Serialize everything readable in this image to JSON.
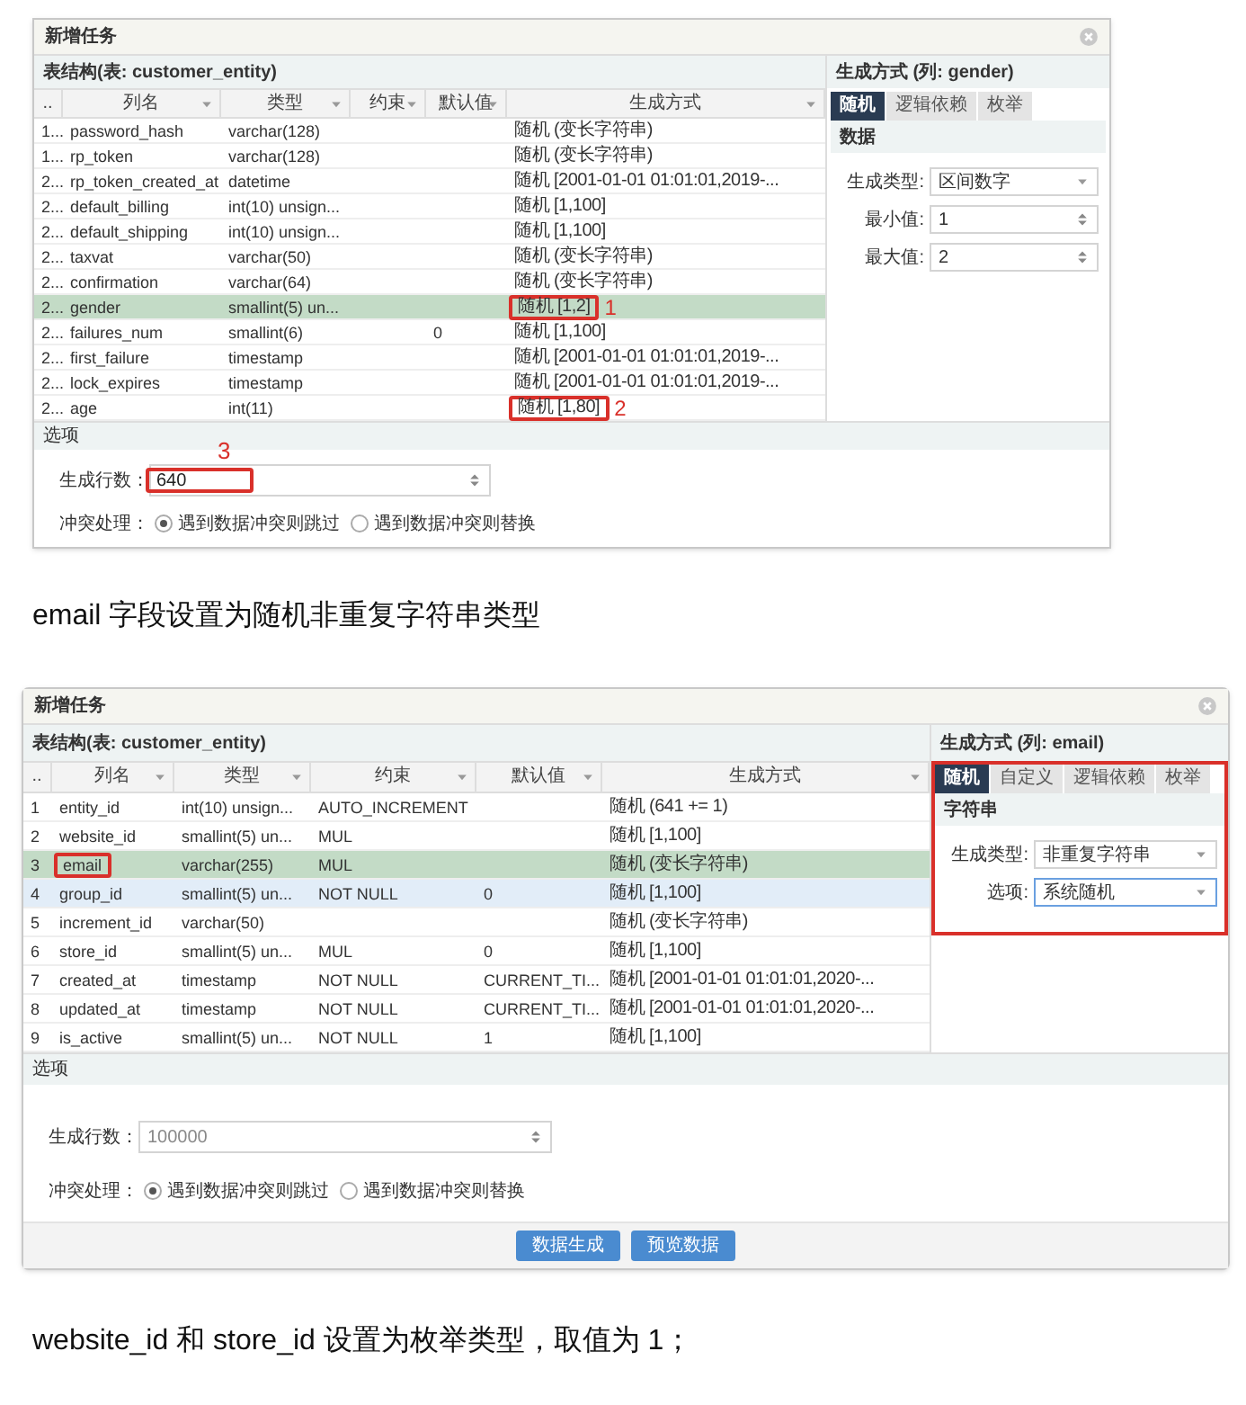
{
  "content": [
    {
      "kind": "dialog",
      "title": "新增任务",
      "table_title": "表结构(表: customer_entity)",
      "columns": [
        "..",
        "列名",
        "类型",
        "约束",
        "默认值",
        "生成方式"
      ],
      "rows": [
        {
          "index": "1...",
          "name": "password_hash",
          "type": "varchar(128)",
          "method": "随机 (变长字符串)",
          "selected": false,
          "hovered": false
        },
        {
          "index": "1...",
          "name": "rp_token",
          "type": "varchar(128)",
          "method": "随机 (变长字符串)",
          "selected": false,
          "hovered": false
        },
        {
          "index": "2...",
          "name": "rp_token_created_at",
          "type": "datetime",
          "method": "随机 [2001-01-01 01:01:01,2019-...",
          "selected": false,
          "hovered": false
        },
        {
          "index": "2...",
          "name": "default_billing",
          "type": "int(10) unsign...",
          "method": "随机 [1,100]",
          "selected": false,
          "hovered": false
        },
        {
          "index": "2...",
          "name": "default_shipping",
          "type": "int(10) unsign...",
          "method": "随机 [1,100]",
          "selected": false,
          "hovered": false
        },
        {
          "index": "2...",
          "name": "taxvat",
          "type": "varchar(50)",
          "method": "随机 (变长字符串)",
          "selected": false,
          "hovered": false
        },
        {
          "index": "2...",
          "name": "confirmation",
          "type": "varchar(64)",
          "method": "随机 (变长字符串)",
          "selected": false,
          "hovered": false
        },
        {
          "index": "2...",
          "name": "gender",
          "type": "smallint(5) un...",
          "method": "随机 [1,2]",
          "selected": true,
          "hovered": false,
          "method_boxed": true,
          "callout": "1"
        },
        {
          "index": "2...",
          "name": "failures_num",
          "type": "smallint(6)",
          "default": "0",
          "method": "随机 [1,100]",
          "selected": false,
          "hovered": false
        },
        {
          "index": "2...",
          "name": "first_failure",
          "type": "timestamp",
          "method": "随机 [2001-01-01 01:01:01,2019-...",
          "selected": false,
          "hovered": false
        },
        {
          "index": "2...",
          "name": "lock_expires",
          "type": "timestamp",
          "method": "随机 [2001-01-01 01:01:01,2019-...",
          "selected": false,
          "hovered": false
        },
        {
          "index": "2...",
          "name": "age",
          "type": "int(11)",
          "method": "随机 [1,80]",
          "selected": false,
          "hovered": false,
          "method_boxed": true,
          "callout": "2"
        }
      ],
      "panel": {
        "title": "生成方式 (列: gender)",
        "highlighted": false,
        "tabs": [
          {
            "label": "随机",
            "selected": true
          },
          {
            "label": "逻辑依赖",
            "selected": false
          },
          {
            "label": "枚举",
            "selected": false
          }
        ],
        "section": "数据",
        "fields": [
          {
            "kind": "select",
            "label": "生成类型:",
            "value": "区间数字",
            "focused": false
          },
          {
            "kind": "spinner",
            "label": "最小值:",
            "value": "1",
            "focused": false
          },
          {
            "kind": "spinner",
            "label": "最大值:",
            "value": "2",
            "focused": false
          }
        ]
      },
      "options_title": "选项",
      "row_count": {
        "label": "生成行数：",
        "value": "640",
        "highlighted": true,
        "callout": "3"
      },
      "conflict": {
        "label": "冲突处理：",
        "options": [
          {
            "label": "遇到数据冲突则跳过",
            "selected": true
          },
          {
            "label": "遇到数据冲突则替换",
            "selected": false
          }
        ]
      }
    },
    {
      "kind": "paragraph",
      "text": "email 字段设置为随机非重复字符串类型"
    },
    {
      "kind": "dialog",
      "title": "新增任务",
      "table_title": "表结构(表: customer_entity)",
      "columns": [
        "..",
        "列名",
        "类型",
        "约束",
        "默认值",
        "生成方式"
      ],
      "rows": [
        {
          "index": "1",
          "name": "entity_id",
          "type": "int(10) unsign...",
          "constraint": "AUTO_INCREMENT",
          "method": "随机 (641 += 1)",
          "selected": false,
          "hovered": false
        },
        {
          "index": "2",
          "name": "website_id",
          "type": "smallint(5) un...",
          "constraint": "MUL",
          "method": "随机 [1,100]",
          "selected": false,
          "hovered": false
        },
        {
          "index": "3",
          "name": "email",
          "type": "varchar(255)",
          "constraint": "MUL",
          "method": "随机 (变长字符串)",
          "selected": true,
          "hovered": false,
          "name_boxed": true
        },
        {
          "index": "4",
          "name": "group_id",
          "type": "smallint(5) un...",
          "constraint": "NOT NULL",
          "default": "0",
          "method": "随机 [1,100]",
          "selected": false,
          "hovered": true
        },
        {
          "index": "5",
          "name": "increment_id",
          "type": "varchar(50)",
          "method": "随机 (变长字符串)",
          "selected": false,
          "hovered": false
        },
        {
          "index": "6",
          "name": "store_id",
          "type": "smallint(5) un...",
          "constraint": "MUL",
          "default": "0",
          "method": "随机 [1,100]",
          "selected": false,
          "hovered": false
        },
        {
          "index": "7",
          "name": "created_at",
          "type": "timestamp",
          "constraint": "NOT NULL",
          "default": "CURRENT_TI...",
          "method": "随机 [2001-01-01 01:01:01,2020-...",
          "selected": false,
          "hovered": false
        },
        {
          "index": "8",
          "name": "updated_at",
          "type": "timestamp",
          "constraint": "NOT NULL",
          "default": "CURRENT_TI...",
          "method": "随机 [2001-01-01 01:01:01,2020-...",
          "selected": false,
          "hovered": false
        },
        {
          "index": "9",
          "name": "is_active",
          "type": "smallint(5) un...",
          "constraint": "NOT NULL",
          "default": "1",
          "method": "随机 [1,100]",
          "selected": false,
          "hovered": false
        }
      ],
      "panel": {
        "title": "生成方式 (列: email)",
        "highlighted": true,
        "tabs": [
          {
            "label": "随机",
            "selected": true
          },
          {
            "label": "自定义",
            "selected": false
          },
          {
            "label": "逻辑依赖",
            "selected": false
          },
          {
            "label": "枚举",
            "selected": false
          }
        ],
        "section": "字符串",
        "fields": [
          {
            "kind": "select",
            "label": "生成类型:",
            "value": "非重复字符串",
            "focused": false
          },
          {
            "kind": "select",
            "label": "选项:",
            "value": "系统随机",
            "focused": true
          }
        ]
      },
      "options_title": "选项",
      "row_count": {
        "label": "生成行数：",
        "placeholder": "100000",
        "highlighted": false
      },
      "conflict": {
        "label": "冲突处理：",
        "options": [
          {
            "label": "遇到数据冲突则跳过",
            "selected": true
          },
          {
            "label": "遇到数据冲突则替换",
            "selected": false
          }
        ]
      },
      "buttons": [
        "数据生成",
        "预览数据"
      ]
    },
    {
      "kind": "paragraph",
      "text": "website_id 和 store_id 设置为枚举类型，取值为 1；"
    }
  ]
}
